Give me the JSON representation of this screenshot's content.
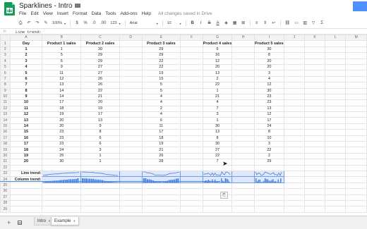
{
  "app": {
    "title": "Sparklines - Intro",
    "status": "All changes saved in Drive",
    "menu": [
      "File",
      "Edit",
      "View",
      "Insert",
      "Format",
      "Data",
      "Tools",
      "Add-ons",
      "Help"
    ]
  },
  "toolbar": {
    "zoom": "100%",
    "currency": "$",
    "percent": "%",
    "decimals_down": ".0",
    "decimals_up": ".00",
    "number_format": "123",
    "font": "Arial",
    "font_size": "10",
    "bold": "B",
    "italic": "I",
    "strike": "S",
    "text_color": "A"
  },
  "formula_bar": {
    "fx": "fx",
    "value": "Line trend:"
  },
  "columns": [
    "A",
    "B",
    "C",
    "D",
    "E",
    "F",
    "G",
    "H",
    "I",
    "J",
    "K",
    "L",
    "M",
    "N"
  ],
  "header_row": [
    "Day",
    "Product 1 sales",
    "Product 2 sales",
    "Product 3 sales",
    "Product 4 sales",
    "Product 5 sales"
  ],
  "rows": [
    [
      1,
      1,
      30,
      29,
      6,
      30
    ],
    [
      2,
      5,
      29,
      29,
      16,
      8
    ],
    [
      3,
      5,
      29,
      22,
      12,
      20
    ],
    [
      4,
      9,
      27,
      22,
      20,
      20
    ],
    [
      5,
      11,
      27,
      19,
      13,
      3
    ],
    [
      6,
      12,
      26,
      15,
      2,
      4
    ],
    [
      7,
      13,
      26,
      5,
      22,
      12
    ],
    [
      8,
      14,
      22,
      5,
      1,
      30
    ],
    [
      9,
      14,
      21,
      4,
      21,
      23
    ],
    [
      10,
      17,
      20,
      4,
      4,
      23
    ],
    [
      11,
      18,
      19,
      2,
      7,
      13
    ],
    [
      12,
      19,
      17,
      4,
      3,
      12
    ],
    [
      13,
      20,
      13,
      6,
      1,
      17
    ],
    [
      14,
      20,
      9,
      11,
      30,
      24
    ],
    [
      15,
      23,
      8,
      17,
      13,
      8
    ],
    [
      16,
      23,
      6,
      18,
      8,
      10
    ],
    [
      17,
      23,
      6,
      19,
      30,
      3
    ],
    [
      18,
      24,
      3,
      21,
      27,
      22
    ],
    [
      19,
      25,
      1,
      26,
      22,
      2
    ],
    [
      20,
      30,
      1,
      28,
      7,
      29
    ]
  ],
  "labels": {
    "line_trend": "Line trend:",
    "column_trend": "Column trend:"
  },
  "empty_row_numbers": [
    25,
    26,
    27,
    28,
    29
  ],
  "tabs": {
    "inactive": "Intro",
    "active": "Example"
  },
  "colors": {
    "sparkline": "#4a7fd6",
    "selection": "#dfe9fb",
    "brand": "#0f9d58"
  }
}
